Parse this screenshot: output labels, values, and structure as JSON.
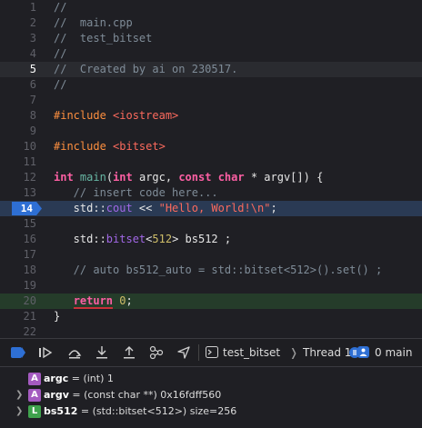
{
  "editor": {
    "lines": [
      {
        "num": "1",
        "tokens": [
          {
            "t": "comment",
            "s": "//"
          }
        ]
      },
      {
        "num": "2",
        "tokens": [
          {
            "t": "comment",
            "s": "//  main.cpp"
          }
        ]
      },
      {
        "num": "3",
        "tokens": [
          {
            "t": "comment",
            "s": "//  test_bitset"
          }
        ]
      },
      {
        "num": "4",
        "tokens": [
          {
            "t": "comment",
            "s": "//"
          }
        ]
      },
      {
        "num": "5",
        "tokens": [
          {
            "t": "comment",
            "s": "//  Created by ai on 230517."
          }
        ]
      },
      {
        "num": "6",
        "tokens": [
          {
            "t": "comment",
            "s": "//"
          }
        ]
      },
      {
        "num": "7",
        "tokens": []
      },
      {
        "num": "8",
        "tokens": [
          {
            "t": "preproc",
            "s": "#include "
          },
          {
            "t": "string",
            "s": "<iostream>"
          }
        ]
      },
      {
        "num": "9",
        "tokens": []
      },
      {
        "num": "10",
        "tokens": [
          {
            "t": "preproc",
            "s": "#include "
          },
          {
            "t": "string",
            "s": "<bitset>"
          }
        ]
      },
      {
        "num": "11",
        "tokens": []
      },
      {
        "num": "12",
        "tokens": [
          {
            "t": "keyword",
            "s": "int"
          },
          {
            "t": "plain",
            "s": " "
          },
          {
            "t": "func",
            "s": "main"
          },
          {
            "t": "plain",
            "s": "("
          },
          {
            "t": "keyword",
            "s": "int"
          },
          {
            "t": "plain",
            "s": " argc, "
          },
          {
            "t": "keyword",
            "s": "const"
          },
          {
            "t": "plain",
            "s": " "
          },
          {
            "t": "keyword",
            "s": "char"
          },
          {
            "t": "plain",
            "s": " * argv[]) {"
          }
        ]
      },
      {
        "num": "13",
        "tokens": [
          {
            "t": "comment",
            "s": "   // insert code here..."
          }
        ]
      },
      {
        "num": "14",
        "tokens": [
          {
            "t": "plain",
            "s": "   std::"
          },
          {
            "t": "type",
            "s": "cout"
          },
          {
            "t": "plain",
            "s": " << "
          },
          {
            "t": "string",
            "s": "\"Hello, World!\\n\""
          },
          {
            "t": "plain",
            "s": ";"
          }
        ]
      },
      {
        "num": "15",
        "tokens": []
      },
      {
        "num": "16",
        "tokens": [
          {
            "t": "plain",
            "s": "   std::"
          },
          {
            "t": "type",
            "s": "bitset"
          },
          {
            "t": "plain",
            "s": "<"
          },
          {
            "t": "number",
            "s": "512"
          },
          {
            "t": "plain",
            "s": "> bs512 ;"
          }
        ]
      },
      {
        "num": "17",
        "tokens": []
      },
      {
        "num": "18",
        "tokens": [
          {
            "t": "comment",
            "s": "   // auto bs512_auto = std::bitset<512>().set() ;"
          }
        ]
      },
      {
        "num": "19",
        "tokens": []
      },
      {
        "num": "20",
        "tokens": [
          {
            "t": "plain",
            "s": "   "
          },
          {
            "t": "keyword",
            "s": "return"
          },
          {
            "t": "plain",
            "s": " "
          },
          {
            "t": "number",
            "s": "0"
          },
          {
            "t": "plain",
            "s": ";"
          }
        ]
      },
      {
        "num": "21",
        "tokens": [
          {
            "t": "plain",
            "s": "}"
          }
        ]
      },
      {
        "num": "22",
        "tokens": []
      }
    ]
  },
  "debug_bar": {
    "breadcrumb": {
      "target": "test_bitset",
      "thread": "Thread 1",
      "frame": "0 main"
    },
    "accent": "#2e6fd4"
  },
  "variables": [
    {
      "badge": "A",
      "badge_color": "#a45ac0",
      "name": "argc",
      "detail": " = (int) 1",
      "expandable": false
    },
    {
      "badge": "A",
      "badge_color": "#a45ac0",
      "name": "argv",
      "detail": " = (const char **) 0x16fdff560",
      "expandable": true
    },
    {
      "badge": "L",
      "badge_color": "#3fa34d",
      "name": "bs512",
      "detail": " = (std::bitset<512>) size=256",
      "expandable": true
    }
  ]
}
